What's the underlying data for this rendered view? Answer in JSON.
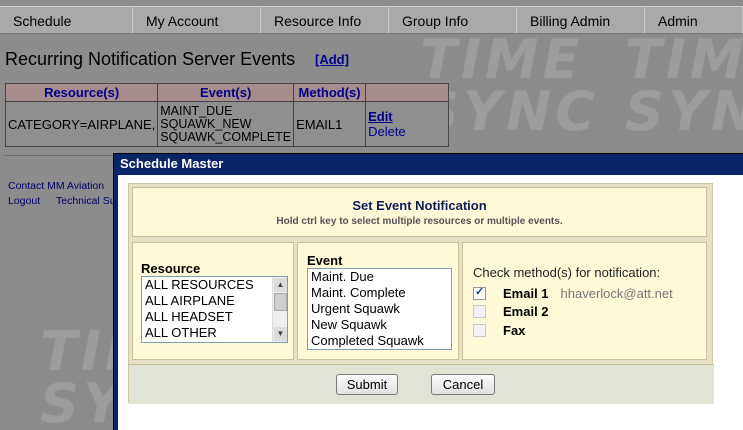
{
  "nav": {
    "items": [
      {
        "label": "Schedule"
      },
      {
        "label": "My Account"
      },
      {
        "label": "Resource Info"
      },
      {
        "label": "Group Info"
      },
      {
        "label": "Billing Admin"
      },
      {
        "label": "Admin"
      }
    ]
  },
  "watermark": {
    "line1": "TIME",
    "line2": "SYNC"
  },
  "page": {
    "title": "Recurring Notification Server Events",
    "add_label": "[Add]"
  },
  "table": {
    "headers": [
      "Resource(s)",
      "Event(s)",
      "Method(s)"
    ],
    "row": {
      "resource": "CATEGORY=AIRPLANE,",
      "events": [
        "MAINT_DUE",
        "SQUAWK_NEW",
        "SQUAWK_COMPLETE"
      ],
      "method": "EMAIL1",
      "edit_label": "Edit",
      "delete_label": "Delete"
    }
  },
  "footer": {
    "contact": "Contact MM Aviation",
    "logout": "Logout",
    "technical": "Technical Su"
  },
  "modal": {
    "title": "Schedule Master",
    "heading": "Set Event Notification",
    "subheading": "Hold ctrl key to select multiple resources or multiple events.",
    "resource_label": "Resource",
    "resources": [
      "ALL RESOURCES",
      "ALL AIRPLANE",
      "ALL HEADSET",
      "ALL OTHER"
    ],
    "event_label": "Event",
    "events": [
      "Maint. Due",
      "Maint. Complete",
      "Urgent Squawk",
      "New Squawk",
      "Completed Squawk"
    ],
    "method_prompt": "Check method(s) for notification:",
    "methods": [
      {
        "label": "Email 1",
        "detail": "hhaverlock@att.net",
        "checked": true
      },
      {
        "label": "Email 2",
        "detail": "",
        "checked": false
      },
      {
        "label": "Fax",
        "detail": "",
        "checked": false
      }
    ],
    "submit_label": "Submit",
    "cancel_label": "Cancel"
  }
}
